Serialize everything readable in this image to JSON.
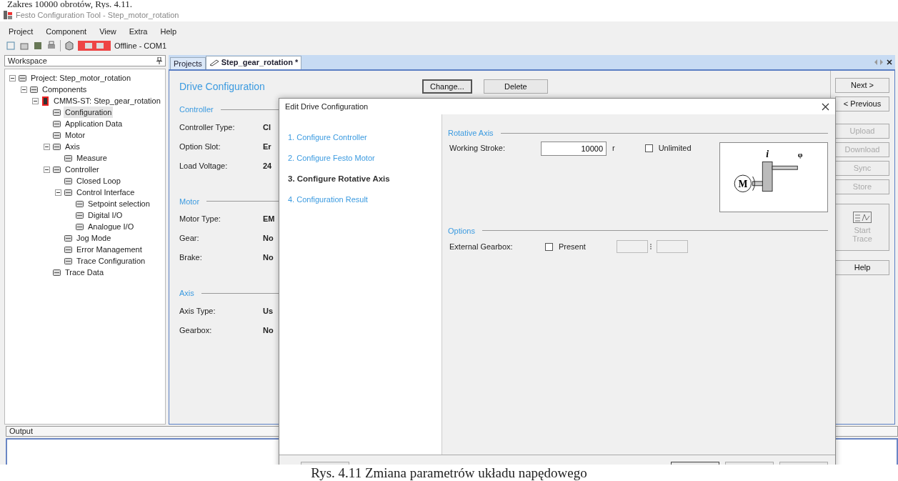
{
  "document_text_top": "Zakres 10000 obrotów, Rys. 4.11.",
  "window": {
    "title": "Festo Configuration Tool - Step_motor_rotation"
  },
  "menu": [
    "Project",
    "Component",
    "View",
    "Extra",
    "Help"
  ],
  "toolbar": {
    "status": "Offline - COM1"
  },
  "workspace": {
    "title": "Workspace",
    "tree": [
      {
        "label": "Project: Step_motor_rotation",
        "selected": false,
        "expanded": true,
        "children": [
          {
            "label": "Components",
            "selected": false,
            "expanded": true,
            "children": [
              {
                "label": "CMMS-ST: Step_gear_rotation",
                "selected": false,
                "expanded": true,
                "children": [
                  {
                    "label": "Configuration",
                    "selected": true
                  },
                  {
                    "label": "Application Data",
                    "selected": false
                  },
                  {
                    "label": "Motor",
                    "selected": false
                  },
                  {
                    "label": "Axis",
                    "selected": false,
                    "expanded": true,
                    "children": [
                      {
                        "label": "Measure",
                        "selected": false
                      }
                    ]
                  },
                  {
                    "label": "Controller",
                    "selected": false,
                    "expanded": true,
                    "children": [
                      {
                        "label": "Closed Loop",
                        "selected": false
                      },
                      {
                        "label": "Control Interface",
                        "selected": false,
                        "expanded": true,
                        "children": [
                          {
                            "label": "Setpoint selection",
                            "selected": false
                          },
                          {
                            "label": "Digital I/O",
                            "selected": false
                          },
                          {
                            "label": "Analogue I/O",
                            "selected": false
                          }
                        ]
                      },
                      {
                        "label": "Jog Mode",
                        "selected": false
                      },
                      {
                        "label": "Error Management",
                        "selected": false
                      },
                      {
                        "label": "Trace Configuration",
                        "selected": false
                      }
                    ]
                  },
                  {
                    "label": "Trace Data",
                    "selected": false
                  }
                ]
              }
            ]
          }
        ]
      }
    ]
  },
  "tabs": [
    {
      "label": "Projects",
      "selected": false
    },
    {
      "label": "Step_gear_rotation *",
      "selected": true
    }
  ],
  "drive_configuration": {
    "title": "Drive Configuration",
    "buttons": [
      "Change...",
      "Delete"
    ],
    "sections": [
      {
        "title": "Controller",
        "fields": [
          {
            "label": "Controller Type:",
            "value": "Cl"
          },
          {
            "label": "Option Slot:",
            "value": "Er"
          },
          {
            "label": "Load Voltage:",
            "value": "24"
          }
        ]
      },
      {
        "title": "Motor",
        "fields": [
          {
            "label": "Motor Type:",
            "value": "EM"
          },
          {
            "label": "Gear:",
            "value": "No"
          },
          {
            "label": "Brake:",
            "value": "No"
          }
        ]
      },
      {
        "title": "Axis",
        "fields": [
          {
            "label": "Axis Type:",
            "value": "Us"
          },
          {
            "label": "Gearbox:",
            "value": "No"
          }
        ]
      }
    ]
  },
  "side_buttons": [
    {
      "label": "Next >",
      "disabled": false
    },
    {
      "label": "< Previous",
      "disabled": false
    },
    {
      "label": "Upload",
      "disabled": true
    },
    {
      "label": "Download",
      "disabled": true
    },
    {
      "label": "Sync",
      "disabled": true
    },
    {
      "label": "Store",
      "disabled": true
    },
    {
      "label": "Start Trace",
      "disabled": true,
      "kind": "icon"
    },
    {
      "label": "Help",
      "disabled": false
    }
  ],
  "dialog": {
    "title": "Edit Drive Configuration",
    "steps": [
      {
        "label": "1. Configure Controller",
        "selected": false
      },
      {
        "label": "2. Configure Festo Motor",
        "selected": false
      },
      {
        "label": "3. Configure Rotative Axis",
        "selected": true
      },
      {
        "label": "4. Configuration Result",
        "selected": false
      }
    ],
    "rotative_axis": {
      "title": "Rotative Axis",
      "working_stroke": {
        "label": "Working Stroke:",
        "value": "10000",
        "unit": "r"
      },
      "unlimited": {
        "label": "Unlimited",
        "checked": false
      },
      "diagram_labels": [
        "i",
        "φ",
        "M"
      ]
    },
    "options": {
      "title": "Options",
      "external_gearbox": {
        "label": "External Gearbox:",
        "present": {
          "label": "Present",
          "checked": false
        }
      }
    }
  },
  "output": {
    "title": "Output"
  },
  "caption": "Rys. 4.11 Zmiana parametrów układu napędowego"
}
